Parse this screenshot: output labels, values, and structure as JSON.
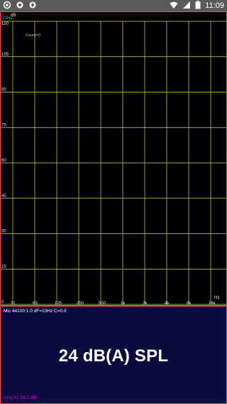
{
  "status_bar": {
    "time": "11:09",
    "left_icons": [
      "record-icon",
      "settings-icon",
      "settings-icon-2"
    ],
    "right_icons": [
      "wifi-icon",
      "signal-icon",
      "battery-icon"
    ]
  },
  "chart_data": {
    "type": "spectrum_grid",
    "series_label": "S1HZ",
    "count_label": "Count=0",
    "ylabel": "dB",
    "xlabel": "Hz",
    "y_ticks": [
      "120",
      "105",
      "90",
      "75",
      "60",
      "45",
      "30",
      "15",
      "0"
    ],
    "x_ticks": [
      "31",
      "63",
      "125",
      "250",
      "500",
      "1k",
      "2k",
      "4k",
      "8k",
      "16k"
    ],
    "ylim": [
      0,
      120
    ],
    "grid": true,
    "colors": {
      "grid": "#d8d84b",
      "frame": "#ff4a5a",
      "series_label": "#3cc6b0",
      "text": "#e6e6e6"
    }
  },
  "spl_panel": {
    "meta": "Mic 44100 1.0 dF=10Hz C=0.0",
    "level": "24 dB(A) SPL",
    "leq": "Leq(A) 24.2 dB",
    "colors": {
      "background": "#0b0b3d",
      "border": "#ff4a5a",
      "leq": "#c000c0"
    }
  }
}
